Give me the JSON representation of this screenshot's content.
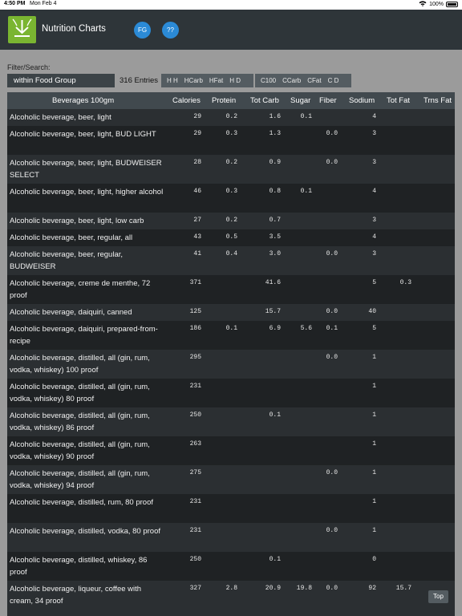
{
  "status": {
    "time": "4:50 PM",
    "date": "Mon Feb 4",
    "battery": "100%"
  },
  "app": {
    "title": "Nutrition Charts",
    "fg_button": "FG",
    "help_button": "??"
  },
  "filter": {
    "label": "Filter/Search:",
    "value": "within Food Group",
    "entries": "316 Entries"
  },
  "sort_groups": [
    [
      "H H",
      "HCarb",
      "HFat",
      "H D"
    ],
    [
      "C100",
      "CCarb",
      "CFat",
      "C D"
    ]
  ],
  "table": {
    "headers": [
      "Beverages 100gm",
      "Calories",
      "Protein",
      "Tot Carb",
      "Sugar",
      "Fiber",
      "Sodium",
      "Tot Fat",
      "Trns Fat"
    ],
    "rows": [
      {
        "name": "Alcoholic beverage, beer, light",
        "vals": [
          "29",
          "0.2",
          "1.6",
          "0.1",
          "",
          "4",
          "",
          ""
        ]
      },
      {
        "name": "Alcoholic beverage, beer, light, BUD LIGHT",
        "vals": [
          "29",
          "0.3",
          "1.3",
          "",
          "0.0",
          "3",
          "",
          ""
        ]
      },
      {
        "name": "Alcoholic beverage, beer, light, BUDWEISER SELECT",
        "vals": [
          "28",
          "0.2",
          "0.9",
          "",
          "0.0",
          "3",
          "",
          ""
        ]
      },
      {
        "name": "Alcoholic beverage, beer, light, higher alcohol",
        "vals": [
          "46",
          "0.3",
          "0.8",
          "0.1",
          "",
          "4",
          "",
          ""
        ]
      },
      {
        "name": "Alcoholic beverage, beer, light, low carb",
        "vals": [
          "27",
          "0.2",
          "0.7",
          "",
          "",
          "3",
          "",
          ""
        ]
      },
      {
        "name": "Alcoholic beverage, beer, regular, all",
        "vals": [
          "43",
          "0.5",
          "3.5",
          "",
          "",
          "4",
          "",
          ""
        ]
      },
      {
        "name": "Alcoholic beverage, beer, regular, BUDWEISER",
        "vals": [
          "41",
          "0.4",
          "3.0",
          "",
          "0.0",
          "3",
          "",
          ""
        ]
      },
      {
        "name": "Alcoholic beverage, creme de menthe, 72 proof",
        "vals": [
          "371",
          "",
          "41.6",
          "",
          "",
          "5",
          "0.3",
          ""
        ]
      },
      {
        "name": "Alcoholic beverage, daiquiri, canned",
        "vals": [
          "125",
          "",
          "15.7",
          "",
          "0.0",
          "40",
          "",
          ""
        ]
      },
      {
        "name": "Alcoholic beverage, daiquiri, prepared-from-recipe",
        "vals": [
          "186",
          "0.1",
          "6.9",
          "5.6",
          "0.1",
          "5",
          "",
          ""
        ]
      },
      {
        "name": "Alcoholic beverage, distilled, all (gin, rum, vodka, whiskey) 100 proof",
        "vals": [
          "295",
          "",
          "",
          "",
          "0.0",
          "1",
          "",
          ""
        ]
      },
      {
        "name": "Alcoholic beverage, distilled, all (gin, rum, vodka, whiskey) 80 proof",
        "vals": [
          "231",
          "",
          "",
          "",
          "",
          "1",
          "",
          ""
        ]
      },
      {
        "name": "Alcoholic beverage, distilled, all (gin, rum, vodka, whiskey) 86 proof",
        "vals": [
          "250",
          "",
          "0.1",
          "",
          "",
          "1",
          "",
          ""
        ]
      },
      {
        "name": "Alcoholic beverage, distilled, all (gin, rum, vodka, whiskey) 90 proof",
        "vals": [
          "263",
          "",
          "",
          "",
          "",
          "1",
          "",
          ""
        ]
      },
      {
        "name": "Alcoholic beverage, distilled, all (gin, rum, vodka, whiskey) 94 proof",
        "vals": [
          "275",
          "",
          "",
          "",
          "0.0",
          "1",
          "",
          ""
        ]
      },
      {
        "name": "Alcoholic beverage, distilled, rum, 80 proof",
        "vals": [
          "231",
          "",
          "",
          "",
          "",
          "1",
          "",
          ""
        ]
      },
      {
        "name": "Alcoholic beverage, distilled, vodka, 80 proof",
        "vals": [
          "231",
          "",
          "",
          "",
          "0.0",
          "1",
          "",
          ""
        ]
      },
      {
        "name": "Alcoholic beverage, distilled, whiskey, 86 proof",
        "vals": [
          "250",
          "",
          "0.1",
          "",
          "",
          "0",
          "",
          ""
        ]
      },
      {
        "name": "Alcoholic beverage, liqueur, coffee with cream, 34 proof",
        "vals": [
          "327",
          "2.8",
          "20.9",
          "19.8",
          "0.0",
          "92",
          "15.7",
          ""
        ]
      }
    ]
  },
  "top_button": "Top"
}
